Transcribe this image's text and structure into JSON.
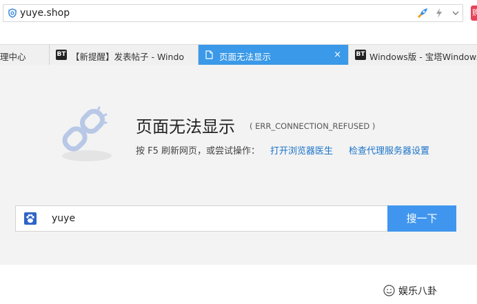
{
  "address_bar": {
    "url": "yuye.shop"
  },
  "corner_badge": "购",
  "tabs": [
    {
      "label": "理中心",
      "icon": "none",
      "active": false
    },
    {
      "label": "【新提醒】发表帖子 - Windo",
      "icon": "bt-icon",
      "icon_text": "BT",
      "active": false
    },
    {
      "label": "页面无法显示",
      "icon": "page-icon",
      "active": true,
      "close": "×"
    },
    {
      "label": "Windows版 - 宝塔Windows",
      "icon": "bt-icon",
      "icon_text": "BT",
      "active": false
    }
  ],
  "error_page": {
    "title": "页面无法显示",
    "code": "( ERR_CONNECTION_REFUSED )",
    "hint": "按 F5 刷新网页，或尝试操作：",
    "link_doctor": "打开浏览器医生",
    "link_proxy": "检查代理服务器设置"
  },
  "search": {
    "value": "yuye",
    "button_label": "搜一下"
  },
  "footer": {
    "label": "娱乐八卦"
  },
  "colors": {
    "accent": "#3a99e8",
    "link": "#1a73c8",
    "content_bg": "#f3f3f3"
  }
}
